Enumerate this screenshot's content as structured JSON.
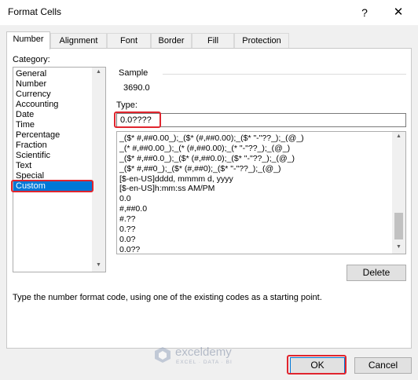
{
  "window": {
    "title": "Format Cells",
    "help_glyph": "?",
    "close_glyph": "✕"
  },
  "tabs": [
    {
      "label": "Number",
      "active": true
    },
    {
      "label": "Alignment"
    },
    {
      "label": "Font"
    },
    {
      "label": "Border"
    },
    {
      "label": "Fill"
    },
    {
      "label": "Protection"
    }
  ],
  "category": {
    "label": "Category:",
    "items": [
      "General",
      "Number",
      "Currency",
      "Accounting",
      "Date",
      "Time",
      "Percentage",
      "Fraction",
      "Scientific",
      "Text",
      "Special",
      "Custom"
    ],
    "selected": "Custom"
  },
  "sample": {
    "label": "Sample",
    "value": "3690.0"
  },
  "type": {
    "label": "Type:",
    "value": "0.0????",
    "formats": [
      "_($* #,##0.00_);_($* (#,##0.00);_($* \"-\"??_);_(@_)",
      "_(* #,##0.00_);_(* (#,##0.00);_(* \"-\"??_);_(@_)",
      "_($* #,##0.0_);_($* (#,##0.0);_($* \"-\"??_);_(@_)",
      "_($* #,##0_);_($* (#,##0);_($* \"-\"??_);_(@_)",
      "[$-en-US]dddd, mmmm d, yyyy",
      "[$-en-US]h:mm:ss AM/PM",
      "0.0",
      "#,##0.0",
      "#.??",
      "0.??",
      "0.0?",
      "0.0??"
    ]
  },
  "buttons": {
    "delete": "Delete",
    "ok": "OK",
    "cancel": "Cancel"
  },
  "hint": "Type the number format code, using one of the existing codes as a starting point.",
  "watermark": {
    "brand": "exceldemy",
    "tagline": "EXCEL · DATA · BI"
  },
  "highlight_color": "#e0252e",
  "selection_color": "#0078d7"
}
